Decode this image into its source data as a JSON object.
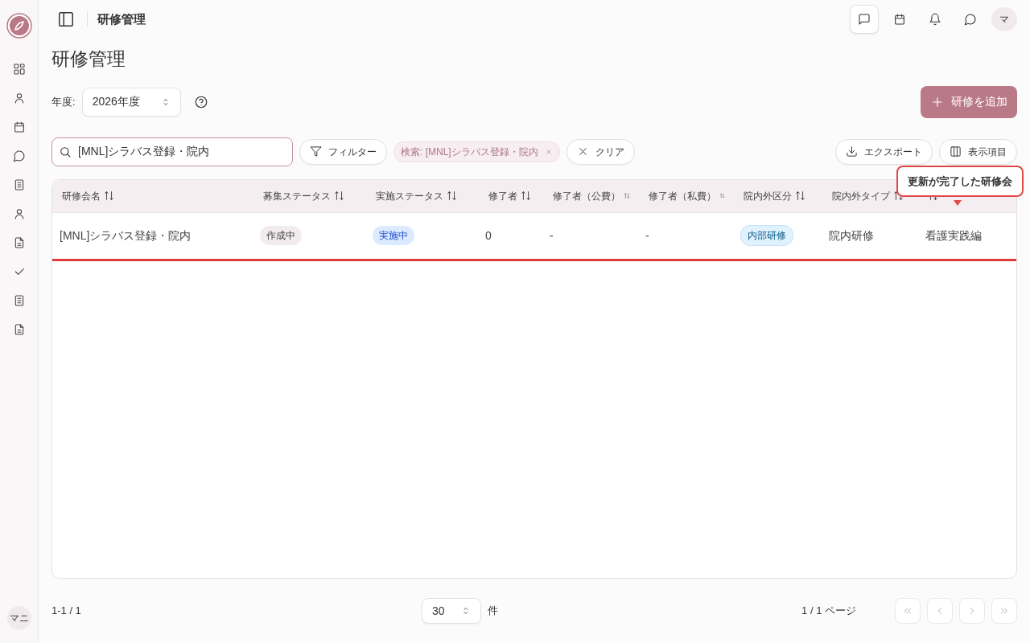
{
  "sidebar": {
    "nav_items": [
      {
        "kind": "grid",
        "selected": false
      },
      {
        "kind": "user",
        "selected": false
      },
      {
        "kind": "calendar",
        "selected": false
      },
      {
        "kind": "chat",
        "selected": false
      },
      {
        "kind": "doc",
        "selected": false
      },
      {
        "kind": "user",
        "selected": false
      },
      {
        "kind": "file",
        "selected": false
      },
      {
        "kind": "check",
        "selected": false
      },
      {
        "kind": "doc",
        "selected": false
      },
      {
        "kind": "file",
        "selected": false
      }
    ],
    "user_avatar": "マニ"
  },
  "header": {
    "title": "研修管理",
    "actions": [
      {
        "kind": "message-square",
        "selected": true
      },
      {
        "kind": "calendar",
        "selected": false
      },
      {
        "kind": "bell",
        "selected": false
      },
      {
        "kind": "chat",
        "selected": false
      }
    ],
    "avatar": "マ"
  },
  "page_title": "研修管理",
  "year": {
    "label": "年度:",
    "value": "2026年度"
  },
  "add_button": "研修を追加",
  "search": {
    "value": "[MNL]シラバス登録・院内"
  },
  "filter_button": "フィルター",
  "chips": [
    {
      "label": "検索: [MNL]シラバス登録・院内"
    }
  ],
  "clear_button": "クリア",
  "export_button": "エクスポート",
  "columns_button": "表示項目",
  "table": {
    "columns": [
      {
        "label": "研修会名",
        "sortable": true
      },
      {
        "label": "募集ステータス",
        "sortable": true
      },
      {
        "label": "実施ステータス",
        "sortable": true
      },
      {
        "label": "修了者",
        "sortable": true
      },
      {
        "label": "修了者（公費）",
        "sortable": true
      },
      {
        "label": "修了者（私費）",
        "sortable": true
      },
      {
        "label": "院内外区分",
        "sortable": true
      },
      {
        "label": "院内外タイプ",
        "sortable": true
      },
      {
        "sortable": true
      }
    ],
    "rows": [
      {
        "highlighted": true,
        "cells": [
          {
            "kind": "text",
            "text": "[MNL]シラバス登録・院内"
          },
          {
            "kind": "badge",
            "text": "作成中",
            "color": "#f3ecee"
          },
          {
            "kind": "badge",
            "text": "実施中",
            "color": "#dbeafe"
          },
          {
            "kind": "text",
            "text": "0"
          },
          {
            "kind": "text",
            "text": "-"
          },
          {
            "kind": "text",
            "text": "-"
          },
          {
            "kind": "badge",
            "text": "内部研修",
            "color": "#e0f2fe"
          },
          {
            "kind": "text",
            "text": "院内研修"
          },
          {
            "kind": "text",
            "text": "看護実践編"
          }
        ]
      }
    ]
  },
  "tooltip": "更新が完了した研修会",
  "footer": {
    "range": "1-1 / 1",
    "page_size": "30",
    "unit": "件",
    "page_info": "1 / 1 ページ",
    "pager": [
      {
        "kind": "first",
        "disabled": true
      },
      {
        "kind": "prev",
        "disabled": true
      },
      {
        "kind": "next",
        "disabled": true
      },
      {
        "kind": "last",
        "disabled": true
      }
    ]
  }
}
